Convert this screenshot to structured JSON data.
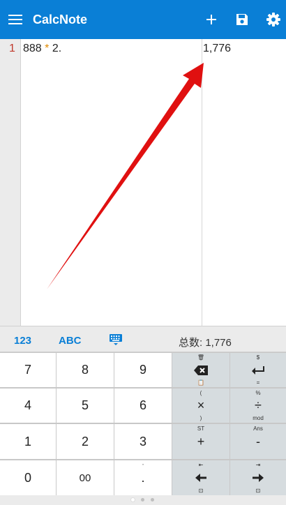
{
  "app": {
    "title": "CalcNote"
  },
  "editor": {
    "line_number": "1",
    "expr_left": "888",
    "expr_op": "*",
    "expr_right": "2.",
    "result": "1,776"
  },
  "kbbar": {
    "tab_123": "123",
    "tab_abc": "ABC",
    "total_label": "总数: 1,776"
  },
  "keys": {
    "k7": "7",
    "k8": "8",
    "k9": "9",
    "k4": "4",
    "k5": "5",
    "k6": "6",
    "k1": "1",
    "k2": "2",
    "k3": "3",
    "k0": "0",
    "k00": "00",
    "kdot": ".",
    "kdot_top": "'",
    "del_top": "🗑",
    "del_bottom": "📋",
    "enter_top": "$",
    "enter_bottom": "=",
    "mul": "×",
    "mul_top": "(",
    "mul_bottom": ")",
    "div": "÷",
    "div_top": "%",
    "div_bottom": "mod",
    "plus": "+",
    "plus_top": "ST",
    "minus": "-",
    "minus_top": "Ans",
    "left": "⬅",
    "left_top": "⇤",
    "left_bottom": "⊡",
    "right": "➜",
    "right_top": "⇥",
    "right_bottom": "⊡"
  },
  "colors": {
    "accent": "#0a7fd6",
    "operator": "#e08a00",
    "line_number": "#c0392b"
  }
}
